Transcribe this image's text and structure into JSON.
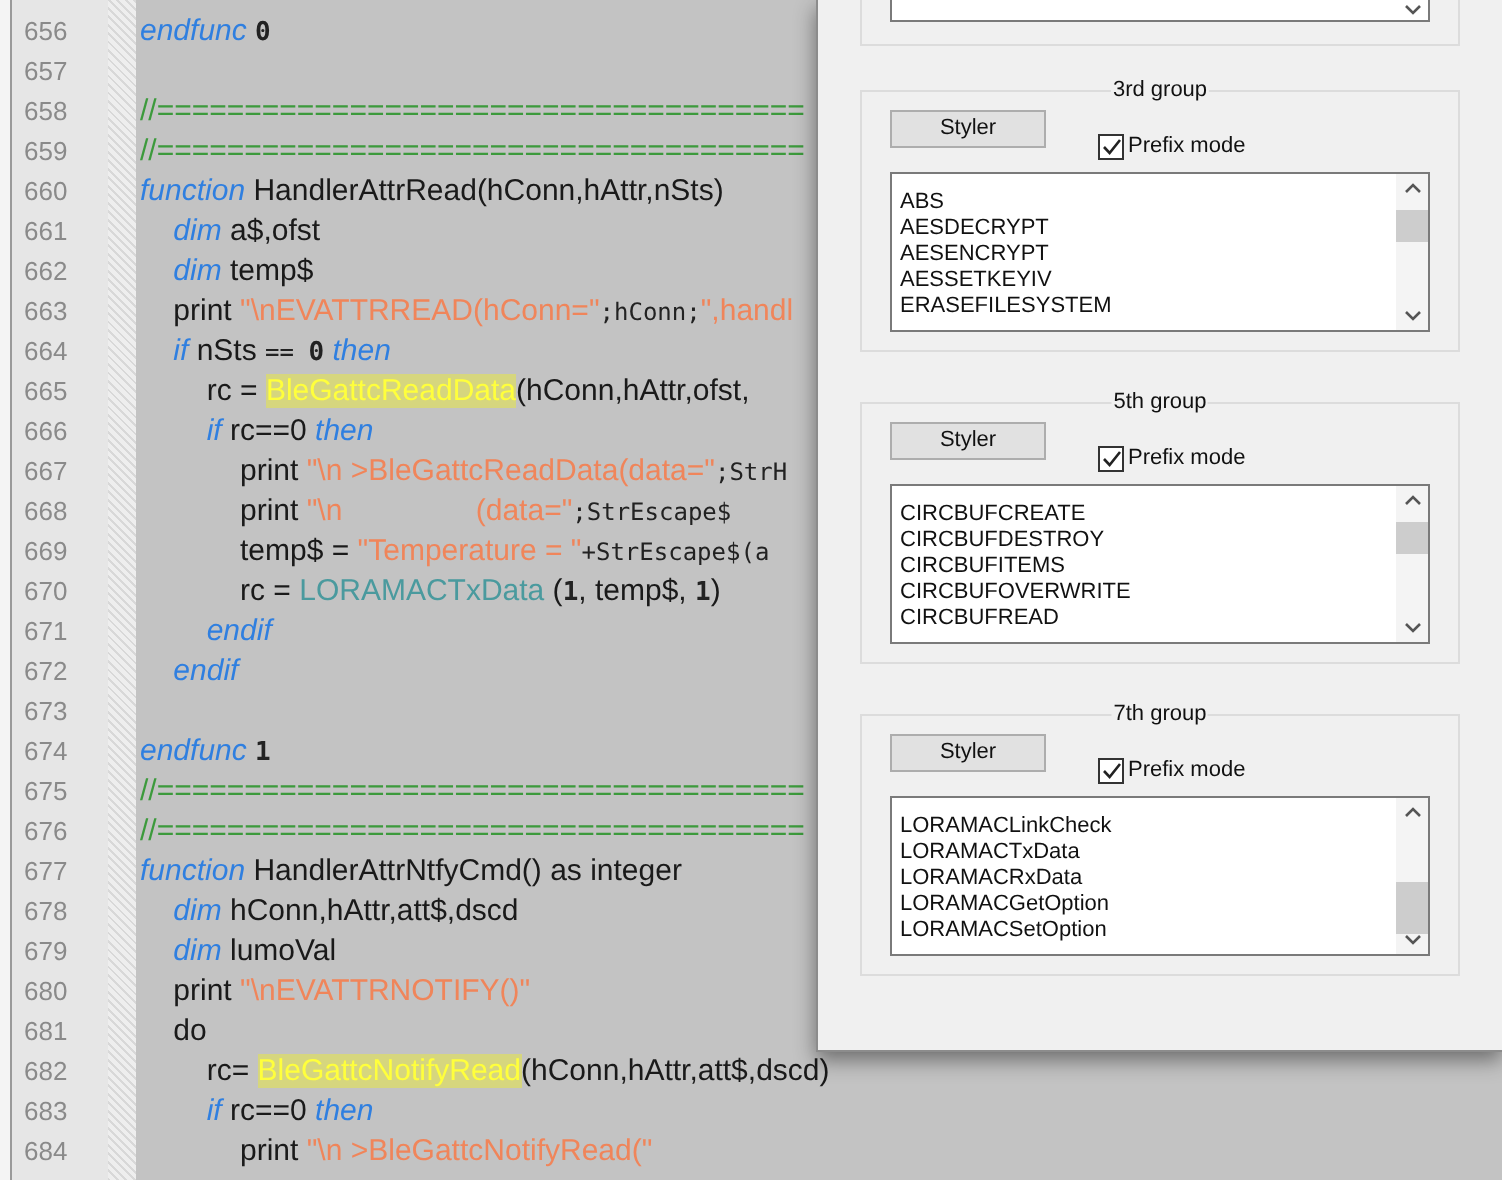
{
  "editor": {
    "lines": [
      {
        "number": "656",
        "tokens": [
          {
            "kind": "kw",
            "text": "endfunc "
          },
          {
            "kind": "num",
            "text": "0"
          }
        ]
      },
      {
        "number": "657"
      },
      {
        "number": "658",
        "tokens": [
          {
            "kind": "cm",
            "text": "//====================================="
          }
        ]
      },
      {
        "number": "659",
        "tokens": [
          {
            "kind": "cm",
            "text": "//====================================="
          }
        ]
      },
      {
        "number": "660",
        "tokens": [
          {
            "kind": "kw",
            "text": "function"
          },
          {
            "kind": "plain",
            "text": " HandlerAttrRead(hConn,hAttr,nSts)"
          }
        ]
      },
      {
        "number": "661",
        "tokens": [
          {
            "kind": "kw",
            "text": "    dim"
          },
          {
            "kind": "plain",
            "text": " a$,ofst"
          }
        ]
      },
      {
        "number": "662",
        "tokens": [
          {
            "kind": "kw",
            "text": "    dim"
          },
          {
            "kind": "plain",
            "text": " temp$"
          }
        ]
      },
      {
        "number": "663",
        "tokens": [
          {
            "kind": "plain",
            "text": "    print "
          },
          {
            "kind": "str",
            "text": "\"\\nEVATTRREAD(hConn=\""
          },
          {
            "kind": "mono",
            "text": ";hConn;"
          },
          {
            "kind": "str",
            "text": "\",handl"
          }
        ]
      },
      {
        "number": "664",
        "tokens": [
          {
            "kind": "kw",
            "text": "    if"
          },
          {
            "kind": "plain",
            "text": " nSts "
          },
          {
            "kind": "mono",
            "text": "== "
          },
          {
            "kind": "num",
            "text": "0"
          },
          {
            "kind": "kw",
            "text": " then"
          }
        ]
      },
      {
        "number": "665",
        "tokens": [
          {
            "kind": "plain",
            "text": "        rc = "
          },
          {
            "kind": "fn",
            "text": "BleGattcReadData"
          },
          {
            "kind": "plain",
            "text": "(hConn,hAttr,ofst,"
          }
        ]
      },
      {
        "number": "666",
        "tokens": [
          {
            "kind": "kw",
            "text": "        if"
          },
          {
            "kind": "plain",
            "text": " rc==0 "
          },
          {
            "kind": "kw",
            "text": "then"
          }
        ]
      },
      {
        "number": "667",
        "tokens": [
          {
            "kind": "plain",
            "text": "            print "
          },
          {
            "kind": "str",
            "text": "\"\\n >BleGattcReadData(data=\""
          },
          {
            "kind": "mono",
            "text": ";StrH"
          }
        ]
      },
      {
        "number": "668",
        "tokens": [
          {
            "kind": "plain",
            "text": "            print "
          },
          {
            "kind": "str",
            "text": "\"\\n                (data=\""
          },
          {
            "kind": "mono",
            "text": ";StrEscape$"
          }
        ]
      },
      {
        "number": "669",
        "tokens": [
          {
            "kind": "plain",
            "text": "            temp$ = "
          },
          {
            "kind": "str",
            "text": "\"Temperature = \""
          },
          {
            "kind": "mono",
            "text": "+StrEscape$(a"
          }
        ]
      },
      {
        "number": "670",
        "tokens": [
          {
            "kind": "plain",
            "text": "            rc = "
          },
          {
            "kind": "lib",
            "text": "LORAMACTxData"
          },
          {
            "kind": "plain",
            "text": " ("
          },
          {
            "kind": "num",
            "text": "1"
          },
          {
            "kind": "plain",
            "text": ", temp$, "
          },
          {
            "kind": "num",
            "text": "1"
          },
          {
            "kind": "plain",
            "text": ")"
          }
        ]
      },
      {
        "number": "671",
        "tokens": [
          {
            "kind": "kw",
            "text": "        endif"
          }
        ]
      },
      {
        "number": "672",
        "tokens": [
          {
            "kind": "kw",
            "text": "    endif"
          }
        ]
      },
      {
        "number": "673"
      },
      {
        "number": "674",
        "tokens": [
          {
            "kind": "kw",
            "text": "endfunc "
          },
          {
            "kind": "num",
            "text": "1"
          }
        ]
      },
      {
        "number": "675",
        "tokens": [
          {
            "kind": "cm",
            "text": "//====================================="
          }
        ]
      },
      {
        "number": "676",
        "tokens": [
          {
            "kind": "cm",
            "text": "//====================================="
          }
        ]
      },
      {
        "number": "677",
        "tokens": [
          {
            "kind": "kw",
            "text": "function"
          },
          {
            "kind": "plain",
            "text": " HandlerAttrNtfyCmd() as integer"
          }
        ]
      },
      {
        "number": "678",
        "tokens": [
          {
            "kind": "kw",
            "text": "    dim"
          },
          {
            "kind": "plain",
            "text": " hConn,hAttr,att$,dscd"
          }
        ]
      },
      {
        "number": "679",
        "tokens": [
          {
            "kind": "kw",
            "text": "    dim"
          },
          {
            "kind": "plain",
            "text": " lumoVal"
          }
        ]
      },
      {
        "number": "680",
        "tokens": [
          {
            "kind": "plain",
            "text": "    print "
          },
          {
            "kind": "str",
            "text": "\"\\nEVATTRNOTIFY()\""
          }
        ]
      },
      {
        "number": "681",
        "tokens": [
          {
            "kind": "plain",
            "text": "    do"
          }
        ]
      },
      {
        "number": "682",
        "tokens": [
          {
            "kind": "plain",
            "text": "        rc= "
          },
          {
            "kind": "fn",
            "text": "BleGattcNotifyRead"
          },
          {
            "kind": "plain",
            "text": "(hConn,hAttr,att$,dscd)"
          }
        ]
      },
      {
        "number": "683",
        "tokens": [
          {
            "kind": "kw",
            "text": "        if"
          },
          {
            "kind": "plain",
            "text": " rc==0 "
          },
          {
            "kind": "kw",
            "text": "then"
          }
        ]
      },
      {
        "number": "684",
        "tokens": [
          {
            "kind": "plain",
            "text": "            print "
          },
          {
            "kind": "str",
            "text": "\"\\n >BleGattcNotifyRead(\""
          }
        ]
      }
    ]
  },
  "dialog": {
    "groups": [
      {
        "title": "3rd group",
        "button": "Styler",
        "checkbox": {
          "label": "Prefix mode",
          "checked": true
        },
        "list": {
          "scrolled": false,
          "items": [
            "ABS",
            "AESDECRYPT",
            "AESENCRYPT",
            "AESSETKEYIV",
            "ERASEFILESYSTEM"
          ]
        }
      },
      {
        "title": "5th group",
        "button": "Styler",
        "checkbox": {
          "label": "Prefix mode",
          "checked": true
        },
        "list": {
          "scrolled": false,
          "items": [
            "CIRCBUFCREATE",
            "CIRCBUFDESTROY",
            "CIRCBUFITEMS",
            "CIRCBUFOVERWRITE",
            "CIRCBUFREAD"
          ]
        }
      },
      {
        "title": "7th group",
        "button": "Styler",
        "checkbox": {
          "label": "Prefix mode",
          "checked": true
        },
        "list": {
          "scrolled": true,
          "items": [
            "LORAMACLinkCheck",
            "LORAMACTxData",
            "LORAMACRxData",
            "LORAMACGetOption",
            "LORAMACSetOption"
          ]
        }
      }
    ]
  }
}
